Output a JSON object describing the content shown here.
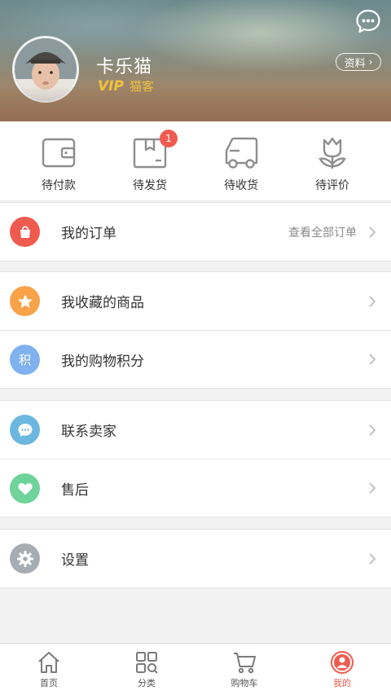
{
  "header": {
    "username": "卡乐猫",
    "vip_badge": "VIP",
    "vip_level": "猫客",
    "profile_button": "资料",
    "chat_icon": "chat-bubble-icon",
    "avatar": "user-avatar"
  },
  "order_status": [
    {
      "label": "待付款",
      "icon": "wallet-icon"
    },
    {
      "label": "待发货",
      "icon": "package-box-icon",
      "badge": "1"
    },
    {
      "label": "待收货",
      "icon": "delivery-truck-icon"
    },
    {
      "label": "待评价",
      "icon": "flower-review-icon"
    }
  ],
  "menu": {
    "orders": {
      "label": "我的订单",
      "extra": "查看全部订单",
      "icon": "shopping-bag-icon",
      "color": "#f05b4f"
    },
    "favorites": {
      "label": "我收藏的商品",
      "icon": "star-icon",
      "color": "#f8a24a"
    },
    "points": {
      "label": "我的购物积分",
      "icon_text": "积",
      "icon": "points-icon",
      "color": "#7fb2ee"
    },
    "contact": {
      "label": "联系卖家",
      "icon": "chat-icon",
      "color": "#6cb7df"
    },
    "aftersale": {
      "label": "售后",
      "icon": "heart-icon",
      "color": "#6fd39a"
    },
    "settings": {
      "label": "设置",
      "icon": "gear-icon",
      "color": "#a6acb3"
    }
  },
  "tabbar": [
    {
      "label": "首页",
      "icon": "home-icon"
    },
    {
      "label": "分类",
      "icon": "category-grid-icon"
    },
    {
      "label": "购物车",
      "icon": "cart-icon"
    },
    {
      "label": "我的",
      "icon": "profile-icon",
      "active": true
    }
  ],
  "colors": {
    "accent": "#f05b4f",
    "vip_gold": "#f2c33c"
  }
}
